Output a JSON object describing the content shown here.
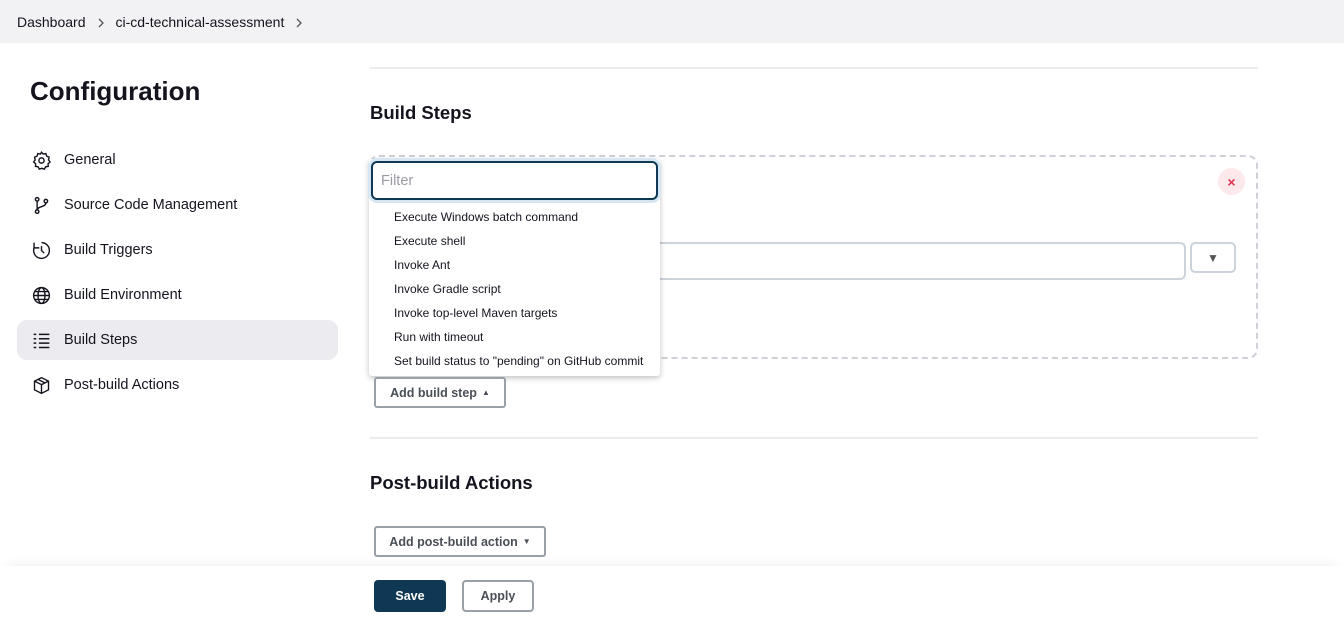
{
  "breadcrumb": {
    "items": [
      "Dashboard",
      "ci-cd-technical-assessment"
    ]
  },
  "sidebar": {
    "title": "Configuration",
    "items": [
      {
        "label": "General",
        "icon": "gear-icon",
        "active": false
      },
      {
        "label": "Source Code Management",
        "icon": "git-branch-icon",
        "active": false
      },
      {
        "label": "Build Triggers",
        "icon": "clock-icon",
        "active": false
      },
      {
        "label": "Build Environment",
        "icon": "globe-icon",
        "active": false
      },
      {
        "label": "Build Steps",
        "icon": "list-icon",
        "active": true
      },
      {
        "label": "Post-build Actions",
        "icon": "package-icon",
        "active": false
      }
    ]
  },
  "main": {
    "build_steps_title": "Build Steps",
    "post_build_title": "Post-build Actions",
    "filter_placeholder": "Filter",
    "dropdown_items": [
      "Execute Windows batch command",
      "Execute shell",
      "Invoke Ant",
      "Invoke Gradle script",
      "Invoke top-level Maven targets",
      "Run with timeout",
      "Set build status to \"pending\" on GitHub commit"
    ],
    "add_build_step_label": "Add build step",
    "add_post_build_label": "Add post-build action",
    "close_symbol": "×",
    "select_arrow_symbol": "▼"
  },
  "footer": {
    "save_label": "Save",
    "apply_label": "Apply"
  },
  "colors": {
    "primary": "#0f3854",
    "danger": "#e0334f",
    "active_bg": "#ececf0"
  }
}
